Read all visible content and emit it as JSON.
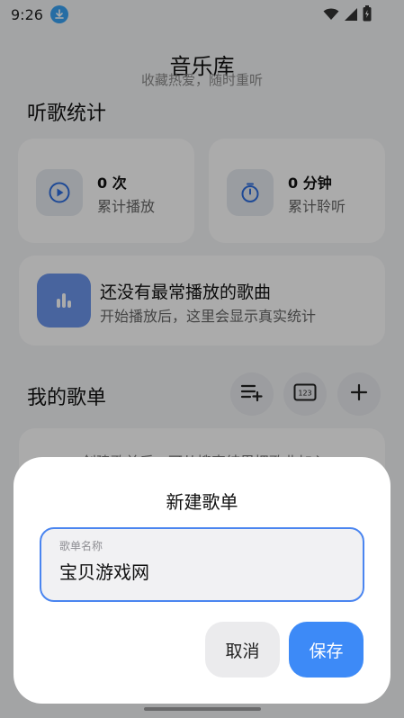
{
  "status_bar": {
    "time": "9:26"
  },
  "header": {
    "title": "音乐库",
    "subtitle": "收藏热爱，随时重听"
  },
  "stats": {
    "section_title": "听歌统计",
    "plays": {
      "value": "0 次",
      "label": "累计播放"
    },
    "listen_time": {
      "value": "0 分钟",
      "label": "累计聆听"
    }
  },
  "top_song": {
    "title": "还没有最常播放的歌曲",
    "subtitle": "开始播放后，这里会显示真实统计"
  },
  "playlists": {
    "section_title": "我的歌单",
    "hint": "创建歌单后，可从搜索结果把歌曲加入"
  },
  "dialog": {
    "title": "新建歌单",
    "field_label": "歌单名称",
    "field_value": "宝贝游戏网",
    "cancel_label": "取消",
    "save_label": "保存"
  },
  "colors": {
    "accent": "#3d8af7",
    "scrim": "rgba(0,0,0,0.33)"
  },
  "icons": [
    "download-icon",
    "wifi-icon",
    "cellular-icon",
    "battery-icon",
    "play-circle-icon",
    "timer-icon",
    "equalizer-icon",
    "playlist-add-icon",
    "numeric-123-icon",
    "plus-icon"
  ]
}
